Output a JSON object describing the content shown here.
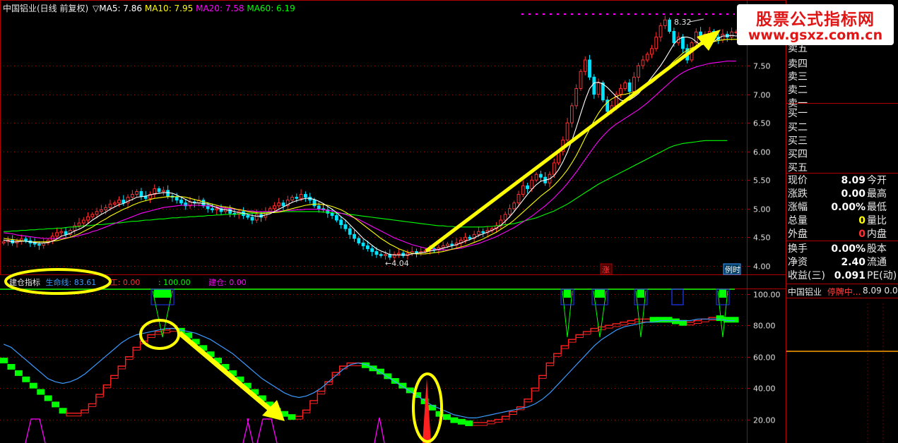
{
  "header": {
    "title": "中国铝业(日线 前复权)",
    "ma_label_prefix": "▽",
    "ma": [
      {
        "label": "MA5: 7.86",
        "color": "#ffffff"
      },
      {
        "label": "MA10: 7.95",
        "color": "#ffff00"
      },
      {
        "label": "MA20: 7.58",
        "color": "#ff00ff"
      },
      {
        "label": "MA60: 6.19",
        "color": "#00ff00"
      }
    ]
  },
  "indicator": {
    "name": "建仓指标",
    "life_line": "生命线: 83.61",
    "fragment_1": "工: 0.00",
    "fragment_2": ": 100.00",
    "build": "建仓: 0.00"
  },
  "watermark": {
    "line1": "股票公式指标网",
    "line2": "www.gsxz.com.cn"
  },
  "chart_data": [
    {
      "type": "line",
      "name": "price",
      "ylim": [
        3.9,
        8.55
      ],
      "yticks": [
        "7.50",
        "7.00",
        "6.50",
        "6.00",
        "5.50",
        "5.00",
        "4.50",
        "4.00"
      ],
      "ytick_values": [
        7.5,
        7.0,
        6.5,
        6.0,
        5.5,
        5.0,
        4.5,
        4.0
      ],
      "x_count": 170,
      "close": [
        4.42,
        4.45,
        4.4,
        4.43,
        4.47,
        4.44,
        4.4,
        4.38,
        4.36,
        4.4,
        4.45,
        4.52,
        4.58,
        4.6,
        4.55,
        4.62,
        4.7,
        4.75,
        4.8,
        4.86,
        4.9,
        4.95,
        4.98,
        5.02,
        5.08,
        5.1,
        5.15,
        5.1,
        5.2,
        5.25,
        5.3,
        5.22,
        5.18,
        5.25,
        5.35,
        5.3,
        5.32,
        5.22,
        5.2,
        5.15,
        5.1,
        5.05,
        5.12,
        5.1,
        5.15,
        5.05,
        5.0,
        4.98,
        5.0,
        4.95,
        5.0,
        4.92,
        4.9,
        4.95,
        4.88,
        4.85,
        4.8,
        4.9,
        4.85,
        4.95,
        5.0,
        5.05,
        5.1,
        5.05,
        5.15,
        5.2,
        5.18,
        5.25,
        5.2,
        5.15,
        5.05,
        5.0,
        4.98,
        4.92,
        4.88,
        4.8,
        4.72,
        4.65,
        4.55,
        4.48,
        4.4,
        4.35,
        4.3,
        4.25,
        4.2,
        4.18,
        4.2,
        4.15,
        4.2,
        4.22,
        4.18,
        4.22,
        4.25,
        4.23,
        4.25,
        4.27,
        4.3,
        4.28,
        4.32,
        4.35,
        4.38,
        4.36,
        4.4,
        4.45,
        4.5,
        4.48,
        4.55,
        4.6,
        4.58,
        4.62,
        4.65,
        4.7,
        4.8,
        4.9,
        5.0,
        5.1,
        5.25,
        5.4,
        5.35,
        5.5,
        5.6,
        5.55,
        5.45,
        5.6,
        5.8,
        6.0,
        6.2,
        6.5,
        6.8,
        7.1,
        7.4,
        7.6,
        7.3,
        7.0,
        7.2,
        6.9,
        6.7,
        6.8,
        7.0,
        7.1,
        7.2,
        7.05,
        7.3,
        7.5,
        7.6,
        7.7,
        7.8,
        8.0,
        8.2,
        8.3,
        8.1,
        7.9,
        8.0,
        7.8,
        7.6,
        7.9,
        8.09,
        8.0,
        8.05,
        8.1,
        8.0,
        7.95,
        8.05,
        8.0,
        8.09,
        8.09
      ],
      "ma5": [
        4.45,
        4.44,
        4.42,
        4.42,
        4.43,
        4.43,
        4.42,
        4.41,
        4.4,
        4.4,
        4.41,
        4.43,
        4.47,
        4.52,
        4.54,
        4.57,
        4.61,
        4.64,
        4.68,
        4.74,
        4.8,
        4.85,
        4.9,
        4.94,
        4.99,
        5.03,
        5.07,
        5.09,
        5.13,
        5.16,
        5.2,
        5.21,
        5.22,
        5.24,
        5.26,
        5.27,
        5.28,
        5.28,
        5.27,
        5.24,
        5.2,
        5.16,
        5.12,
        5.1,
        5.1,
        5.09,
        5.08,
        5.05,
        5.02,
        4.99,
        4.98,
        4.97,
        4.95,
        4.93,
        4.92,
        4.9,
        4.88,
        4.87,
        4.87,
        4.89,
        4.91,
        4.95,
        4.99,
        5.03,
        5.07,
        5.11,
        5.14,
        5.16,
        5.18,
        5.18,
        5.16,
        5.13,
        5.09,
        5.04,
        4.99,
        4.93,
        4.86,
        4.8,
        4.72,
        4.64,
        4.56,
        4.48,
        4.42,
        4.36,
        4.3,
        4.26,
        4.23,
        4.2,
        4.19,
        4.19,
        4.19,
        4.19,
        4.21,
        4.22,
        4.23,
        4.24,
        4.26,
        4.27,
        4.29,
        4.31,
        4.33,
        4.35,
        4.37,
        4.4,
        4.43,
        4.46,
        4.49,
        4.53,
        4.56,
        4.59,
        4.62,
        4.66,
        4.71,
        4.78,
        4.86,
        4.95,
        5.05,
        5.15,
        5.25,
        5.34,
        5.42,
        5.48,
        5.5,
        5.52,
        5.58,
        5.68,
        5.82,
        5.99,
        6.19,
        6.42,
        6.66,
        6.9,
        7.1,
        7.2,
        7.21,
        7.18,
        7.12,
        7.04,
        6.96,
        6.9,
        6.88,
        6.9,
        6.95,
        7.01,
        7.1,
        7.2,
        7.3,
        7.4,
        7.5,
        7.62,
        7.75,
        7.88,
        7.96,
        8.0,
        8.0,
        7.98,
        7.92,
        7.86,
        7.88,
        7.9,
        7.92,
        7.98,
        8.02,
        8.02,
        8.03,
        8.02,
        8.03,
        8.04
      ],
      "ma10": [
        4.48,
        4.47,
        4.46,
        4.45,
        4.44,
        4.43,
        4.42,
        4.42,
        4.42,
        4.42,
        4.42,
        4.43,
        4.44,
        4.46,
        4.48,
        4.5,
        4.53,
        4.56,
        4.6,
        4.64,
        4.68,
        4.73,
        4.78,
        4.82,
        4.87,
        4.91,
        4.95,
        4.99,
        5.02,
        5.06,
        5.09,
        5.12,
        5.14,
        5.16,
        5.18,
        5.19,
        5.2,
        5.21,
        5.21,
        5.21,
        5.21,
        5.2,
        5.18,
        5.16,
        5.14,
        5.12,
        5.1,
        5.08,
        5.06,
        5.04,
        5.03,
        5.02,
        5.0,
        4.98,
        4.97,
        4.95,
        4.94,
        4.93,
        4.92,
        4.92,
        4.93,
        4.93,
        4.94,
        4.96,
        4.98,
        5.0,
        5.02,
        5.04,
        5.06,
        5.07,
        5.08,
        5.08,
        5.07,
        5.06,
        5.04,
        5.01,
        4.98,
        4.94,
        4.89,
        4.84,
        4.78,
        4.72,
        4.66,
        4.6,
        4.54,
        4.48,
        4.43,
        4.38,
        4.34,
        4.3,
        4.27,
        4.24,
        4.22,
        4.21,
        4.21,
        4.21,
        4.22,
        4.23,
        4.24,
        4.25,
        4.27,
        4.29,
        4.31,
        4.33,
        4.35,
        4.38,
        4.41,
        4.44,
        4.47,
        4.51,
        4.55,
        4.59,
        4.64,
        4.69,
        4.74,
        4.8,
        4.87,
        4.94,
        5.01,
        5.08,
        5.15,
        5.22,
        5.28,
        5.34,
        5.41,
        5.49,
        5.58,
        5.68,
        5.8,
        5.93,
        6.08,
        6.24,
        6.39,
        6.54,
        6.67,
        6.78,
        6.86,
        6.92,
        6.96,
        6.99,
        7.0,
        7.02,
        7.04,
        7.06,
        7.1,
        7.15,
        7.2,
        7.26,
        7.33,
        7.41,
        7.5,
        7.58,
        7.65,
        7.72,
        7.77,
        7.81,
        7.84,
        7.86,
        7.88,
        7.9,
        7.92,
        7.94,
        7.95,
        7.96,
        7.96,
        7.96,
        7.96,
        7.95
      ],
      "ma20": [
        4.58,
        4.57,
        4.56,
        4.54,
        4.53,
        4.52,
        4.51,
        4.5,
        4.49,
        4.48,
        4.48,
        4.48,
        4.48,
        4.48,
        4.49,
        4.5,
        4.51,
        4.53,
        4.55,
        4.57,
        4.6,
        4.62,
        4.65,
        4.68,
        4.71,
        4.74,
        4.77,
        4.8,
        4.83,
        4.86,
        4.89,
        4.92,
        4.94,
        4.96,
        4.98,
        5.0,
        5.02,
        5.03,
        5.04,
        5.05,
        5.06,
        5.06,
        5.06,
        5.06,
        5.06,
        5.05,
        5.05,
        5.04,
        5.03,
        5.02,
        5.01,
        5.0,
        4.99,
        4.98,
        4.97,
        4.96,
        4.96,
        4.95,
        4.95,
        4.95,
        4.95,
        4.95,
        4.96,
        4.96,
        4.97,
        4.97,
        4.98,
        4.98,
        4.99,
        4.99,
        4.99,
        4.99,
        4.98,
        4.97,
        4.96,
        4.94,
        4.92,
        4.9,
        4.87,
        4.84,
        4.81,
        4.77,
        4.73,
        4.69,
        4.65,
        4.61,
        4.57,
        4.53,
        4.49,
        4.46,
        4.43,
        4.4,
        4.37,
        4.35,
        4.33,
        4.31,
        4.3,
        4.29,
        4.28,
        4.28,
        4.28,
        4.29,
        4.3,
        4.31,
        4.33,
        4.35,
        4.37,
        4.39,
        4.42,
        4.45,
        4.48,
        4.51,
        4.55,
        4.59,
        4.63,
        4.67,
        4.72,
        4.77,
        4.82,
        4.87,
        4.93,
        4.99,
        5.05,
        5.12,
        5.19,
        5.27,
        5.35,
        5.44,
        5.54,
        5.64,
        5.75,
        5.86,
        5.97,
        6.08,
        6.18,
        6.27,
        6.35,
        6.42,
        6.48,
        6.53,
        6.58,
        6.63,
        6.68,
        6.73,
        6.79,
        6.85,
        6.92,
        6.99,
        7.06,
        7.13,
        7.2,
        7.27,
        7.33,
        7.38,
        7.42,
        7.45,
        7.48,
        7.5,
        7.52,
        7.54,
        7.55,
        7.56,
        7.57,
        7.58,
        7.58,
        7.58
      ],
      "ma60": [
        4.6,
        4.6,
        4.61,
        4.61,
        4.62,
        4.62,
        4.63,
        4.63,
        4.64,
        4.64,
        4.65,
        4.65,
        4.66,
        4.66,
        4.67,
        4.68,
        4.68,
        4.69,
        4.7,
        4.7,
        4.71,
        4.72,
        4.72,
        4.73,
        4.74,
        4.75,
        4.75,
        4.76,
        4.77,
        4.78,
        4.78,
        4.79,
        4.8,
        4.8,
        4.81,
        4.82,
        4.82,
        4.83,
        4.84,
        4.84,
        4.85,
        4.85,
        4.86,
        4.86,
        4.87,
        4.87,
        4.88,
        4.88,
        4.89,
        4.89,
        4.9,
        4.9,
        4.9,
        4.91,
        4.91,
        4.92,
        4.92,
        4.92,
        4.93,
        4.93,
        4.94,
        4.94,
        4.94,
        4.95,
        4.95,
        4.95,
        4.95,
        4.95,
        4.95,
        4.95,
        4.95,
        4.95,
        4.94,
        4.94,
        4.93,
        4.92,
        4.92,
        4.91,
        4.9,
        4.89,
        4.88,
        4.87,
        4.86,
        4.85,
        4.84,
        4.83,
        4.82,
        4.81,
        4.8,
        4.79,
        4.78,
        4.77,
        4.76,
        4.75,
        4.74,
        4.73,
        4.72,
        4.71,
        4.7,
        4.7,
        4.69,
        4.69,
        4.68,
        4.68,
        4.68,
        4.68,
        4.68,
        4.68,
        4.68,
        4.69,
        4.69,
        4.7,
        4.71,
        4.72,
        4.73,
        4.74,
        4.76,
        4.78,
        4.8,
        4.82,
        4.84,
        4.87,
        4.9,
        4.93,
        4.96,
        5.0,
        5.04,
        5.08,
        5.13,
        5.18,
        5.23,
        5.28,
        5.33,
        5.38,
        5.43,
        5.47,
        5.51,
        5.55,
        5.59,
        5.63,
        5.67,
        5.71,
        5.75,
        5.79,
        5.83,
        5.87,
        5.91,
        5.95,
        5.99,
        6.03,
        6.07,
        6.1,
        6.12,
        6.14,
        6.15,
        6.16,
        6.17,
        6.18,
        6.19,
        6.19,
        6.19,
        6.19,
        6.19,
        6.19
      ],
      "annotations": [
        "8.32",
        "4.04",
        "涨",
        "例时"
      ]
    },
    {
      "type": "line",
      "name": "indicator",
      "ylim": [
        5,
        103
      ],
      "yticks": [
        "100.00",
        "80.00",
        "60.00",
        "40.00",
        "20.00"
      ],
      "ytick_values": [
        100,
        80,
        60,
        40,
        20
      ],
      "life_line": [
        68,
        66,
        62,
        58,
        54,
        50,
        46,
        44,
        43,
        44,
        46,
        49,
        53,
        57,
        61,
        65,
        69,
        72,
        74,
        75,
        76,
        77,
        78,
        78,
        77,
        76,
        75,
        73,
        71,
        68,
        65,
        62,
        58,
        54,
        50,
        46,
        43,
        40,
        37,
        35,
        34,
        35,
        37,
        40,
        44,
        48,
        52,
        55,
        56,
        55,
        53,
        50,
        47,
        44,
        41,
        38,
        35,
        32,
        29,
        27,
        25,
        23,
        22,
        21,
        21,
        22,
        23,
        24,
        25,
        26,
        27,
        28,
        30,
        33,
        37,
        42,
        47,
        52,
        57,
        62,
        67,
        71,
        74,
        77,
        79,
        80,
        81,
        82,
        82,
        83,
        83,
        83,
        83,
        83,
        84,
        84,
        84,
        84,
        83,
        83
      ],
      "step_line": [
        58,
        54,
        50,
        46,
        42,
        38,
        34,
        30,
        26,
        24,
        24,
        26,
        30,
        36,
        42,
        48,
        54,
        60,
        66,
        70,
        74,
        76,
        77,
        78,
        77,
        74,
        70,
        66,
        62,
        58,
        54,
        50,
        46,
        42,
        38,
        34,
        30,
        26,
        24,
        22,
        22,
        26,
        32,
        38,
        44,
        50,
        54,
        56,
        56,
        55,
        53,
        51,
        48,
        45,
        42,
        39,
        36,
        32,
        28,
        24,
        22,
        20,
        19,
        18,
        18,
        18,
        19,
        20,
        22,
        25,
        28,
        33,
        40,
        48,
        56,
        62,
        67,
        71,
        74,
        76,
        78,
        79,
        80,
        81,
        82,
        83,
        84,
        84,
        84,
        84,
        84,
        83,
        82,
        82,
        83,
        84,
        85,
        85,
        84,
        84
      ],
      "step_falling": [
        true,
        true,
        true,
        true,
        true,
        true,
        true,
        true,
        true,
        false,
        false,
        false,
        false,
        false,
        false,
        false,
        false,
        false,
        false,
        false,
        false,
        false,
        false,
        false,
        true,
        true,
        true,
        true,
        true,
        true,
        true,
        true,
        true,
        true,
        true,
        true,
        true,
        true,
        true,
        true,
        false,
        false,
        false,
        false,
        false,
        false,
        false,
        false,
        false,
        true,
        true,
        true,
        true,
        true,
        true,
        true,
        true,
        true,
        true,
        true,
        true,
        true,
        true,
        true,
        false,
        false,
        false,
        false,
        false,
        false,
        false,
        false,
        false,
        false,
        false,
        false,
        false,
        false,
        false,
        false,
        false,
        false,
        false,
        false,
        false,
        false,
        false,
        false,
        true,
        true,
        true,
        true,
        true,
        false,
        false,
        false,
        false,
        true,
        true,
        true
      ]
    }
  ],
  "quote_panel": {
    "order_book": [
      "卖五",
      "卖四",
      "卖三",
      "卖二",
      "卖一",
      "买一",
      "买二",
      "买三",
      "买四",
      "买五"
    ],
    "rows": [
      {
        "label": "现价",
        "value": "8.09",
        "value_color": "#ffffff",
        "right": "今开"
      },
      {
        "label": "涨跌",
        "value": "0.00",
        "value_color": "#ffffff",
        "right": "最高"
      },
      {
        "label": "涨幅",
        "value": "0.00%",
        "value_color": "#ffffff",
        "right": "最低"
      },
      {
        "label": "总量",
        "value": "0",
        "value_color": "#ffff00",
        "right": "量比"
      },
      {
        "label": "外盘",
        "value": "0",
        "value_color": "#ff3030",
        "right": "内盘"
      },
      {
        "label": "换手",
        "value": "0.00%",
        "value_color": "#ffffff",
        "right": "股本"
      },
      {
        "label": "净资",
        "value": "2.40",
        "value_color": "#ffffff",
        "right": "流通"
      },
      {
        "label": "收益(三)",
        "value": "0.091",
        "value_color": "#ffffff",
        "right": "PE(动)"
      }
    ],
    "mini": {
      "name": "中国铝业",
      "status": "停牌中...",
      "value": "8.09 0.00"
    }
  },
  "colors": {
    "grid_red": "#b00000",
    "up": "#ff3030",
    "down": "#00e5ff",
    "ma5": "#ffffff",
    "ma10": "#ffff00",
    "ma20": "#ff00ff",
    "ma60": "#00ff00",
    "arrow": "#ffff00",
    "life_line": "#3a9bff",
    "step_up": "#ff2020",
    "step_down": "#00ff00",
    "highlight_ring": "#ffff00"
  }
}
